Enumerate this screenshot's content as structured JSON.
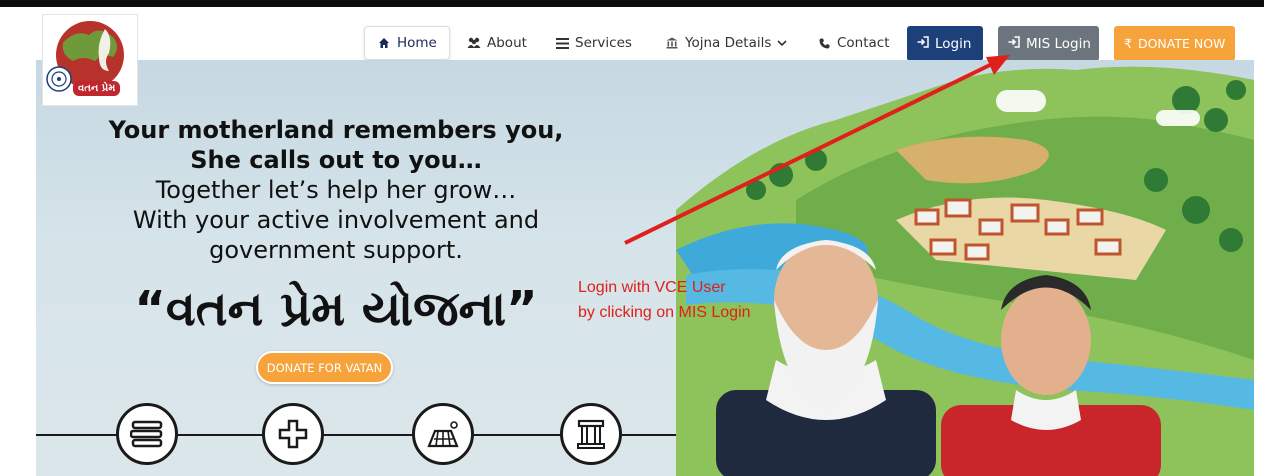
{
  "nav": {
    "items": [
      {
        "label": "Home",
        "icon": "home-icon",
        "active": true
      },
      {
        "label": "About",
        "icon": "users-icon"
      },
      {
        "label": "Services",
        "icon": "list-icon"
      },
      {
        "label": "Yojna Details",
        "icon": "building-icon",
        "dropdown": true
      },
      {
        "label": "Contact",
        "icon": "phone-icon"
      }
    ],
    "login_label": "Login",
    "mis_login_label": "MIS Login",
    "donate_label": "DONATE NOW",
    "donate_symbol": "₹"
  },
  "logo": {
    "text": "વતન પ્રેમ"
  },
  "hero": {
    "line1": "Your motherland remembers you,",
    "line2": "She calls out to you…",
    "line3": "Together let’s help her grow…",
    "line4": "With your active involvement and",
    "line5": "government support.",
    "yojna_title": "“વતન પ્રેમ યોજના”",
    "donate_button": "DONATE FOR VATAN"
  },
  "annotation": {
    "line1": "Login with VCE User",
    "line2": "by clicking on MIS Login",
    "color": "#e0201a"
  },
  "colors": {
    "login_bg": "#1d3f7a",
    "mis_bg": "#6c757d",
    "donate_bg": "#f6a33b"
  },
  "service_icons": [
    "education-icon",
    "health-icon",
    "solar-panel-icon",
    "infrastructure-icon"
  ]
}
